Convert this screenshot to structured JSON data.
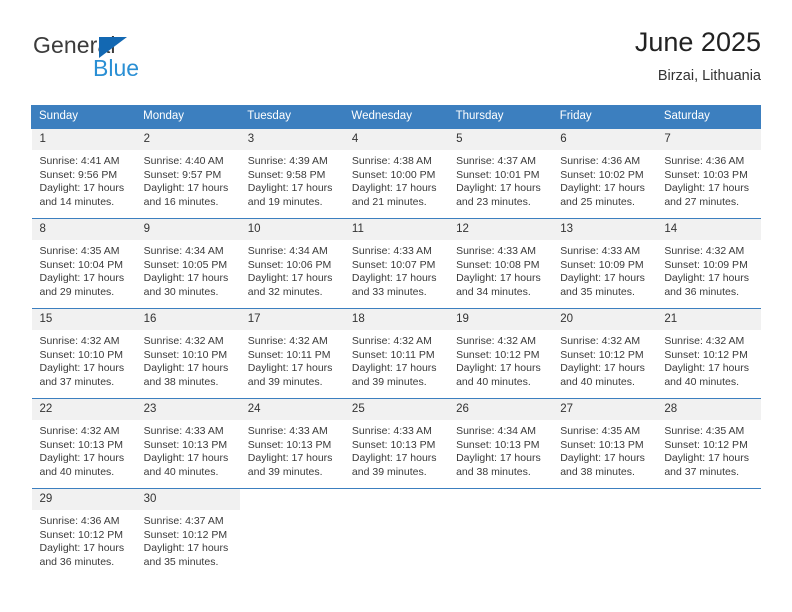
{
  "brand": {
    "name_part1": "General",
    "name_part2": "Blue",
    "colors": {
      "flag": "#1368b2",
      "blue_text": "#2a8fd4",
      "header": "#3c7fbf",
      "daynum_bg": "#f1f1f1"
    }
  },
  "header": {
    "title": "June 2025",
    "subtitle": "Birzai, Lithuania"
  },
  "weekdays": [
    "Sunday",
    "Monday",
    "Tuesday",
    "Wednesday",
    "Thursday",
    "Friday",
    "Saturday"
  ],
  "labels": {
    "sunrise": "Sunrise:",
    "sunset": "Sunset:",
    "daylight": "Daylight:"
  },
  "weeks": [
    [
      {
        "day": "1",
        "sunrise": "Sunrise: 4:41 AM",
        "sunset": "Sunset: 9:56 PM",
        "daylight_line1": "Daylight: 17 hours",
        "daylight_line2": "and 14 minutes."
      },
      {
        "day": "2",
        "sunrise": "Sunrise: 4:40 AM",
        "sunset": "Sunset: 9:57 PM",
        "daylight_line1": "Daylight: 17 hours",
        "daylight_line2": "and 16 minutes."
      },
      {
        "day": "3",
        "sunrise": "Sunrise: 4:39 AM",
        "sunset": "Sunset: 9:58 PM",
        "daylight_line1": "Daylight: 17 hours",
        "daylight_line2": "and 19 minutes."
      },
      {
        "day": "4",
        "sunrise": "Sunrise: 4:38 AM",
        "sunset": "Sunset: 10:00 PM",
        "daylight_line1": "Daylight: 17 hours",
        "daylight_line2": "and 21 minutes."
      },
      {
        "day": "5",
        "sunrise": "Sunrise: 4:37 AM",
        "sunset": "Sunset: 10:01 PM",
        "daylight_line1": "Daylight: 17 hours",
        "daylight_line2": "and 23 minutes."
      },
      {
        "day": "6",
        "sunrise": "Sunrise: 4:36 AM",
        "sunset": "Sunset: 10:02 PM",
        "daylight_line1": "Daylight: 17 hours",
        "daylight_line2": "and 25 minutes."
      },
      {
        "day": "7",
        "sunrise": "Sunrise: 4:36 AM",
        "sunset": "Sunset: 10:03 PM",
        "daylight_line1": "Daylight: 17 hours",
        "daylight_line2": "and 27 minutes."
      }
    ],
    [
      {
        "day": "8",
        "sunrise": "Sunrise: 4:35 AM",
        "sunset": "Sunset: 10:04 PM",
        "daylight_line1": "Daylight: 17 hours",
        "daylight_line2": "and 29 minutes."
      },
      {
        "day": "9",
        "sunrise": "Sunrise: 4:34 AM",
        "sunset": "Sunset: 10:05 PM",
        "daylight_line1": "Daylight: 17 hours",
        "daylight_line2": "and 30 minutes."
      },
      {
        "day": "10",
        "sunrise": "Sunrise: 4:34 AM",
        "sunset": "Sunset: 10:06 PM",
        "daylight_line1": "Daylight: 17 hours",
        "daylight_line2": "and 32 minutes."
      },
      {
        "day": "11",
        "sunrise": "Sunrise: 4:33 AM",
        "sunset": "Sunset: 10:07 PM",
        "daylight_line1": "Daylight: 17 hours",
        "daylight_line2": "and 33 minutes."
      },
      {
        "day": "12",
        "sunrise": "Sunrise: 4:33 AM",
        "sunset": "Sunset: 10:08 PM",
        "daylight_line1": "Daylight: 17 hours",
        "daylight_line2": "and 34 minutes."
      },
      {
        "day": "13",
        "sunrise": "Sunrise: 4:33 AM",
        "sunset": "Sunset: 10:09 PM",
        "daylight_line1": "Daylight: 17 hours",
        "daylight_line2": "and 35 minutes."
      },
      {
        "day": "14",
        "sunrise": "Sunrise: 4:32 AM",
        "sunset": "Sunset: 10:09 PM",
        "daylight_line1": "Daylight: 17 hours",
        "daylight_line2": "and 36 minutes."
      }
    ],
    [
      {
        "day": "15",
        "sunrise": "Sunrise: 4:32 AM",
        "sunset": "Sunset: 10:10 PM",
        "daylight_line1": "Daylight: 17 hours",
        "daylight_line2": "and 37 minutes."
      },
      {
        "day": "16",
        "sunrise": "Sunrise: 4:32 AM",
        "sunset": "Sunset: 10:10 PM",
        "daylight_line1": "Daylight: 17 hours",
        "daylight_line2": "and 38 minutes."
      },
      {
        "day": "17",
        "sunrise": "Sunrise: 4:32 AM",
        "sunset": "Sunset: 10:11 PM",
        "daylight_line1": "Daylight: 17 hours",
        "daylight_line2": "and 39 minutes."
      },
      {
        "day": "18",
        "sunrise": "Sunrise: 4:32 AM",
        "sunset": "Sunset: 10:11 PM",
        "daylight_line1": "Daylight: 17 hours",
        "daylight_line2": "and 39 minutes."
      },
      {
        "day": "19",
        "sunrise": "Sunrise: 4:32 AM",
        "sunset": "Sunset: 10:12 PM",
        "daylight_line1": "Daylight: 17 hours",
        "daylight_line2": "and 40 minutes."
      },
      {
        "day": "20",
        "sunrise": "Sunrise: 4:32 AM",
        "sunset": "Sunset: 10:12 PM",
        "daylight_line1": "Daylight: 17 hours",
        "daylight_line2": "and 40 minutes."
      },
      {
        "day": "21",
        "sunrise": "Sunrise: 4:32 AM",
        "sunset": "Sunset: 10:12 PM",
        "daylight_line1": "Daylight: 17 hours",
        "daylight_line2": "and 40 minutes."
      }
    ],
    [
      {
        "day": "22",
        "sunrise": "Sunrise: 4:32 AM",
        "sunset": "Sunset: 10:13 PM",
        "daylight_line1": "Daylight: 17 hours",
        "daylight_line2": "and 40 minutes."
      },
      {
        "day": "23",
        "sunrise": "Sunrise: 4:33 AM",
        "sunset": "Sunset: 10:13 PM",
        "daylight_line1": "Daylight: 17 hours",
        "daylight_line2": "and 40 minutes."
      },
      {
        "day": "24",
        "sunrise": "Sunrise: 4:33 AM",
        "sunset": "Sunset: 10:13 PM",
        "daylight_line1": "Daylight: 17 hours",
        "daylight_line2": "and 39 minutes."
      },
      {
        "day": "25",
        "sunrise": "Sunrise: 4:33 AM",
        "sunset": "Sunset: 10:13 PM",
        "daylight_line1": "Daylight: 17 hours",
        "daylight_line2": "and 39 minutes."
      },
      {
        "day": "26",
        "sunrise": "Sunrise: 4:34 AM",
        "sunset": "Sunset: 10:13 PM",
        "daylight_line1": "Daylight: 17 hours",
        "daylight_line2": "and 38 minutes."
      },
      {
        "day": "27",
        "sunrise": "Sunrise: 4:35 AM",
        "sunset": "Sunset: 10:13 PM",
        "daylight_line1": "Daylight: 17 hours",
        "daylight_line2": "and 38 minutes."
      },
      {
        "day": "28",
        "sunrise": "Sunrise: 4:35 AM",
        "sunset": "Sunset: 10:12 PM",
        "daylight_line1": "Daylight: 17 hours",
        "daylight_line2": "and 37 minutes."
      }
    ],
    [
      {
        "day": "29",
        "sunrise": "Sunrise: 4:36 AM",
        "sunset": "Sunset: 10:12 PM",
        "daylight_line1": "Daylight: 17 hours",
        "daylight_line2": "and 36 minutes."
      },
      {
        "day": "30",
        "sunrise": "Sunrise: 4:37 AM",
        "sunset": "Sunset: 10:12 PM",
        "daylight_line1": "Daylight: 17 hours",
        "daylight_line2": "and 35 minutes."
      },
      {
        "day": "",
        "sunrise": "",
        "sunset": "",
        "daylight_line1": "",
        "daylight_line2": ""
      },
      {
        "day": "",
        "sunrise": "",
        "sunset": "",
        "daylight_line1": "",
        "daylight_line2": ""
      },
      {
        "day": "",
        "sunrise": "",
        "sunset": "",
        "daylight_line1": "",
        "daylight_line2": ""
      },
      {
        "day": "",
        "sunrise": "",
        "sunset": "",
        "daylight_line1": "",
        "daylight_line2": ""
      },
      {
        "day": "",
        "sunrise": "",
        "sunset": "",
        "daylight_line1": "",
        "daylight_line2": ""
      }
    ]
  ]
}
